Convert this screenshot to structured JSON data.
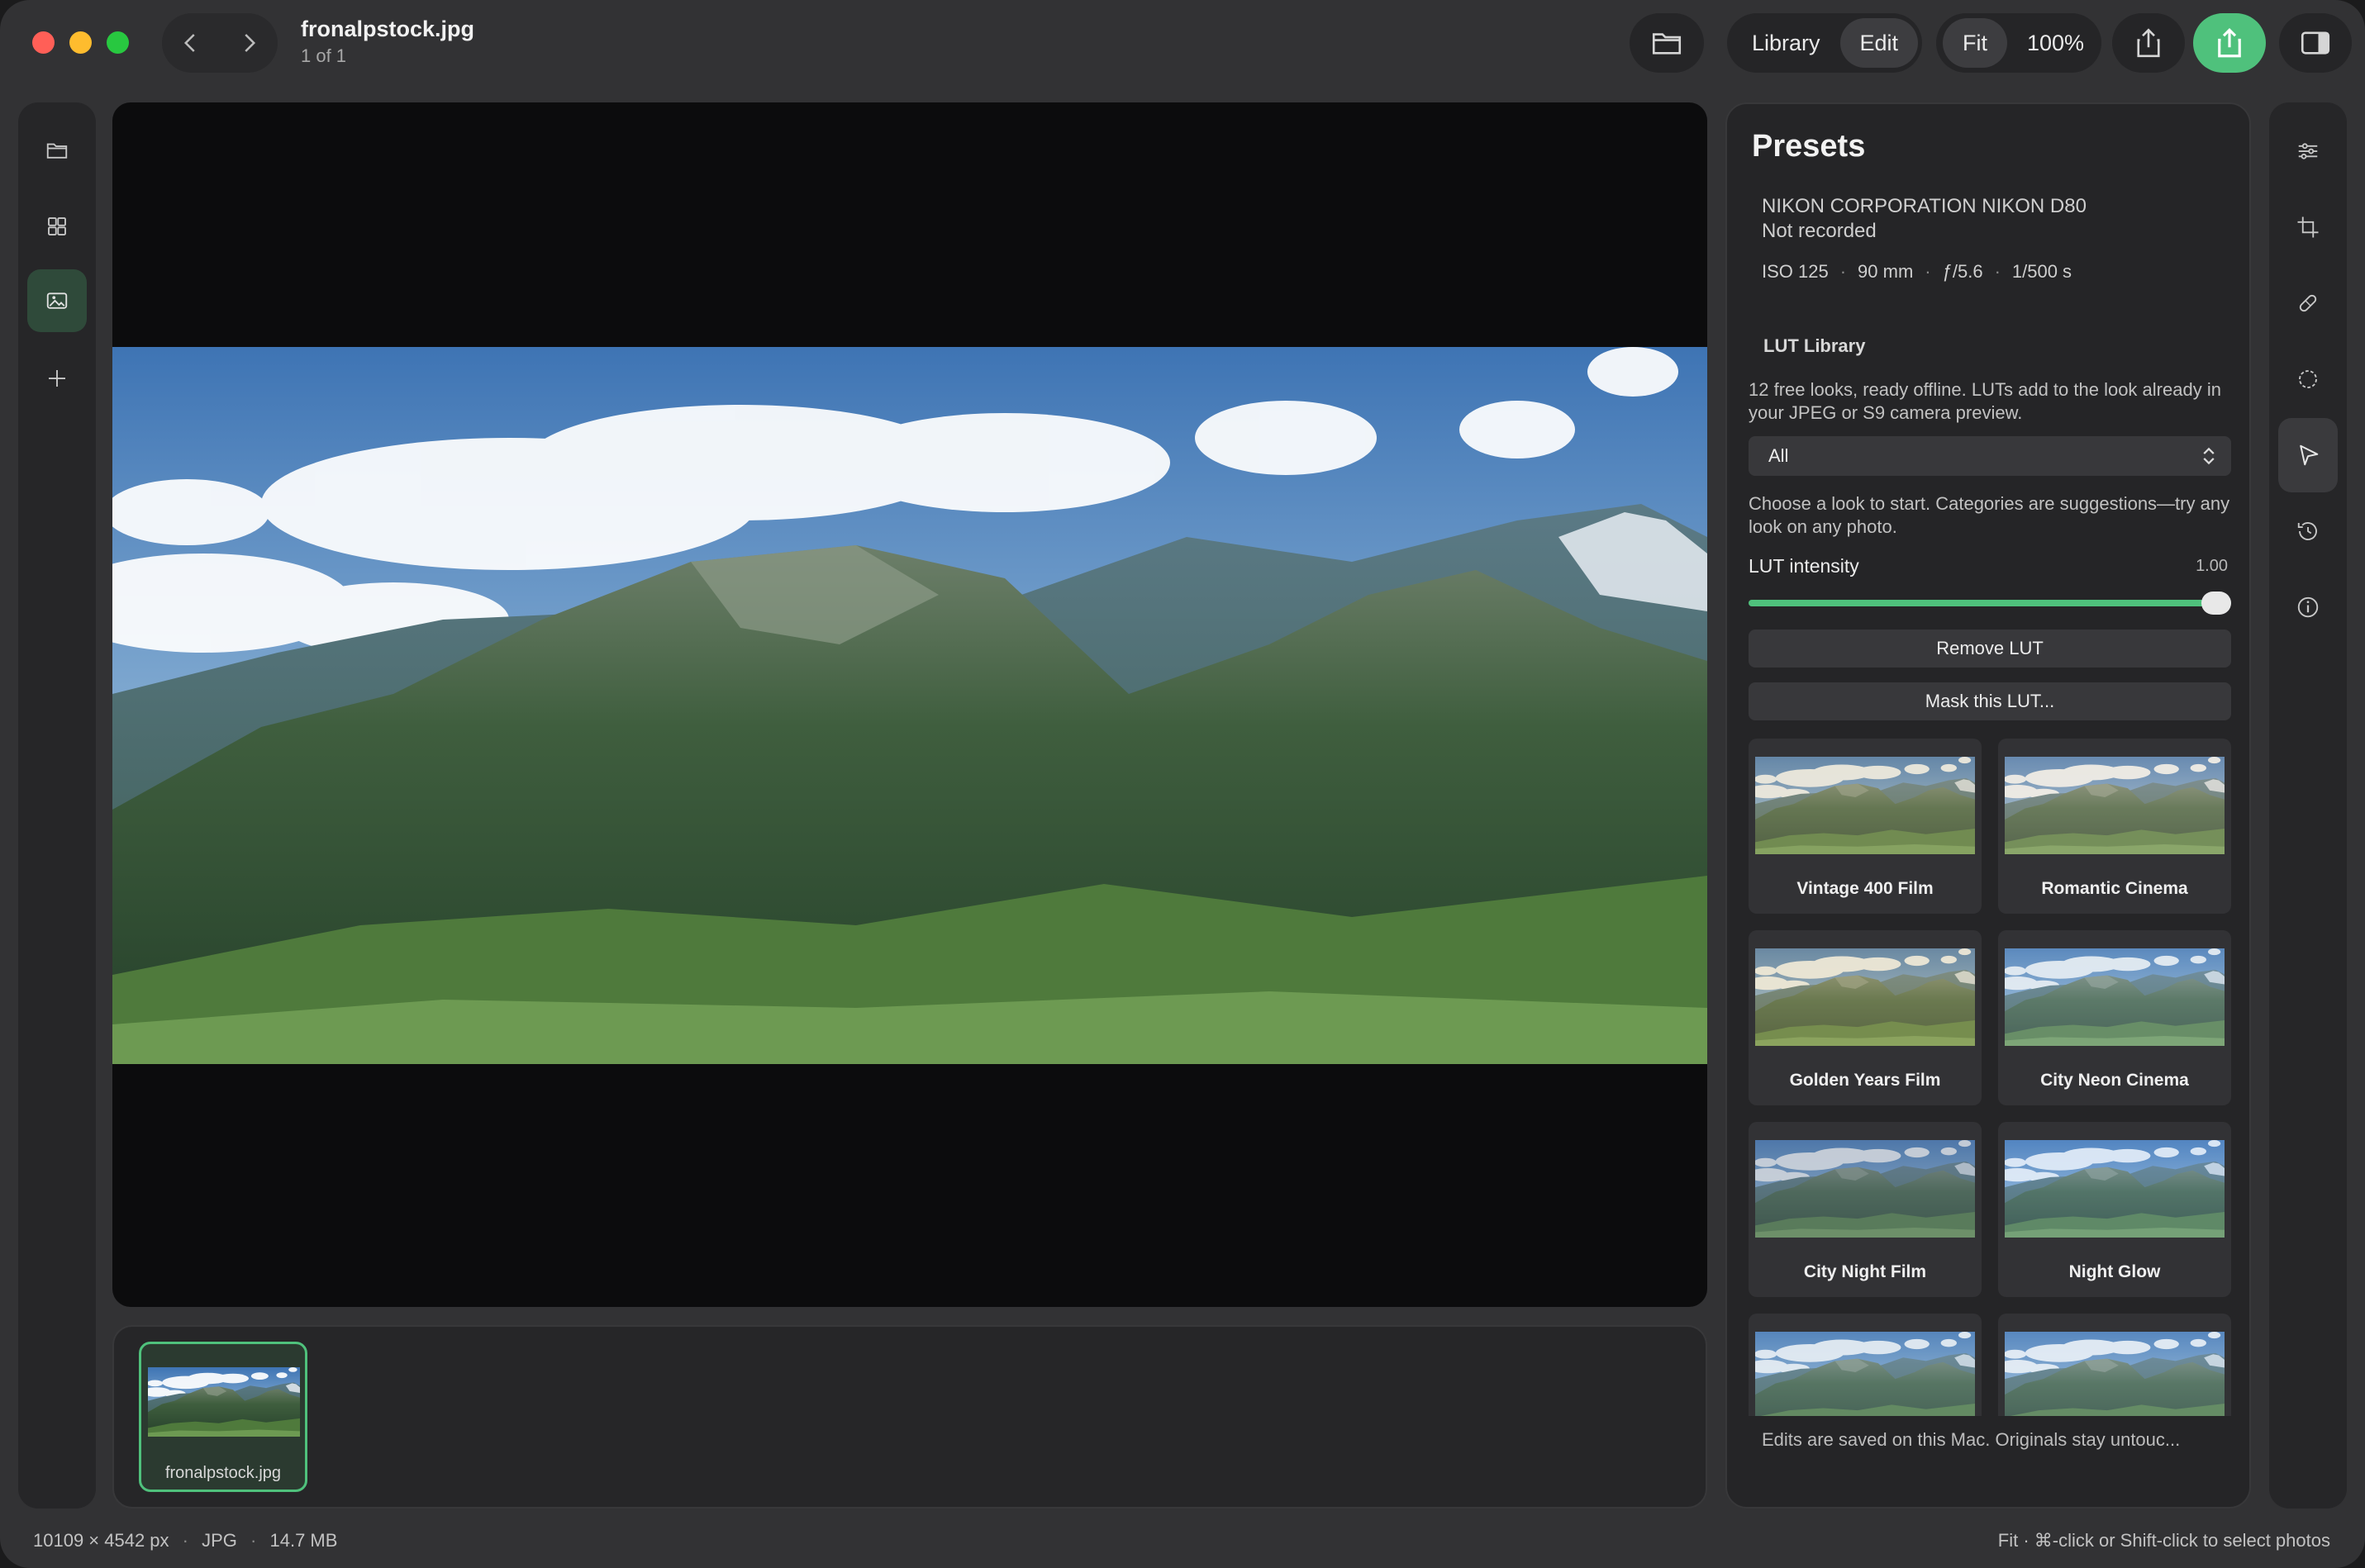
{
  "window": {
    "file_name": "fronalpstock.jpg",
    "file_position": "1 of 1"
  },
  "toolbar": {
    "library_label": "Library",
    "edit_label": "Edit",
    "fit_label": "Fit",
    "zoom_label": "100%",
    "icons": [
      "folder-icon",
      "share-icon",
      "export-icon",
      "sidebar-toggle-icon",
      "back-icon",
      "forward-icon"
    ]
  },
  "left_rail": {
    "items": [
      "folder-icon",
      "grid-icon",
      "image-icon",
      "plus-icon"
    ],
    "active": "image-icon"
  },
  "filmstrip": {
    "items": [
      {
        "label": "fronalpstock.jpg"
      }
    ]
  },
  "presets": {
    "title": "Presets",
    "camera": "NIKON CORPORATION NIKON D80",
    "lens": "Not recorded",
    "exif": {
      "iso": "ISO 125",
      "focal": "90 mm",
      "aperture": "ƒ/5.6",
      "shutter": "1/500 s",
      "separator": "·"
    },
    "lut_heading": "LUT Library",
    "lut_desc": "12 free looks, ready offline. LUTs add to the look already in your JPEG or S9 camera preview.",
    "category_select": "All",
    "choose_desc": "Choose a look to start. Categories are suggestions—try any look on any photo.",
    "intensity_label": "LUT intensity",
    "intensity_value": "1.00",
    "intensity_fraction": 1.0,
    "remove_label": "Remove LUT",
    "mask_label": "Mask this LUT...",
    "looks": [
      {
        "name": "Vintage 400 Film",
        "tint": "#c9b68a"
      },
      {
        "name": "Romantic Cinema",
        "tint": "#d8c6a8"
      },
      {
        "name": "Golden Years Film",
        "tint": "#d2b87a"
      },
      {
        "name": "City Neon Cinema",
        "tint": "#a8c2d8"
      },
      {
        "name": "City Night Film",
        "tint": "#6e7f96"
      },
      {
        "name": "Night Glow",
        "tint": "#8fb8e8"
      },
      {
        "name": "",
        "tint": "#9fbad2"
      },
      {
        "name": "",
        "tint": "#a9c4e0"
      }
    ],
    "footer": "Edits are saved on this Mac. Originals stay untouc..."
  },
  "right_rail": {
    "items": [
      "adjustments-icon",
      "crop-icon",
      "healing-icon",
      "mask-icon",
      "presets-icon",
      "history-icon",
      "info-icon"
    ],
    "active": "presets-icon"
  },
  "status": {
    "dimensions": "10109 × 4542 px",
    "format": "JPG",
    "size": "14.7 MB",
    "separator": "·",
    "hint": "Fit · ⌘-click or Shift-click to select photos"
  },
  "colors": {
    "accent": "#4fc17c",
    "panel": "#252527",
    "window": "#323234"
  }
}
